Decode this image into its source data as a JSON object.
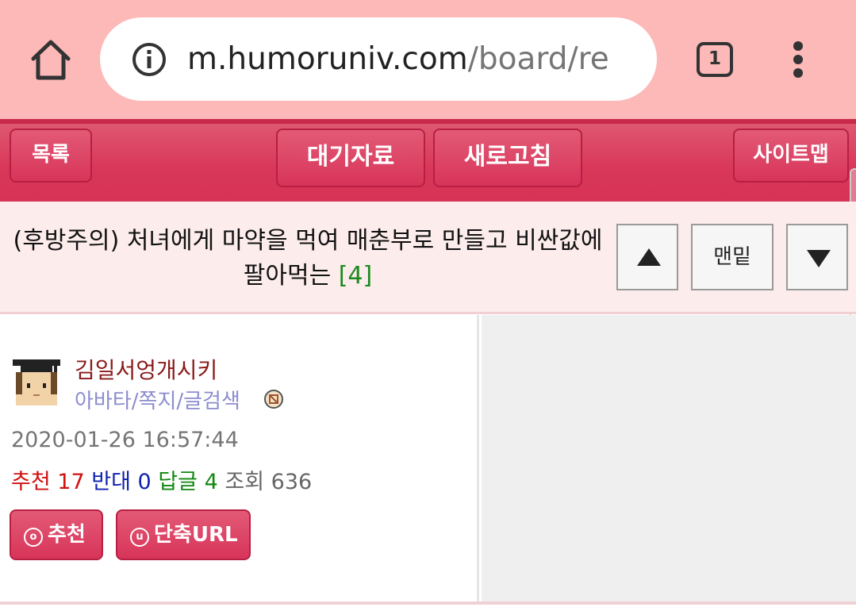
{
  "browser": {
    "url_host": "m.humoruniv.com",
    "url_path": "/board/re",
    "tab_count": "1"
  },
  "toolbar": {
    "list_label": "목록",
    "wait_label": "대기자료",
    "refresh_label": "새로고침",
    "sitemap_label": "사이트맵"
  },
  "post": {
    "title": "(후방주의) 처녀에게 마약을 먹여 매춘부로 만들고 비싼값에 팔아먹는",
    "comment_count": "[4]",
    "nav_bottom_label": "맨밑"
  },
  "author": {
    "name": "김일서엉개시키",
    "links": "아바타/쪽지/글검색"
  },
  "meta": {
    "date": "2020-01-26 16:57:44",
    "recommend_label": "추천",
    "recommend_count": "17",
    "oppose_label": "반대",
    "oppose_count": "0",
    "reply_label": "답글",
    "reply_count": "4",
    "view_label": "조회",
    "view_count": "636"
  },
  "actions": {
    "recommend_button": "추천",
    "shorturl_button": "단축URL"
  },
  "colors": {
    "chrome_bg": "#fdb8b8",
    "accent": "#d8345a",
    "title_bg": "#fcecec"
  }
}
